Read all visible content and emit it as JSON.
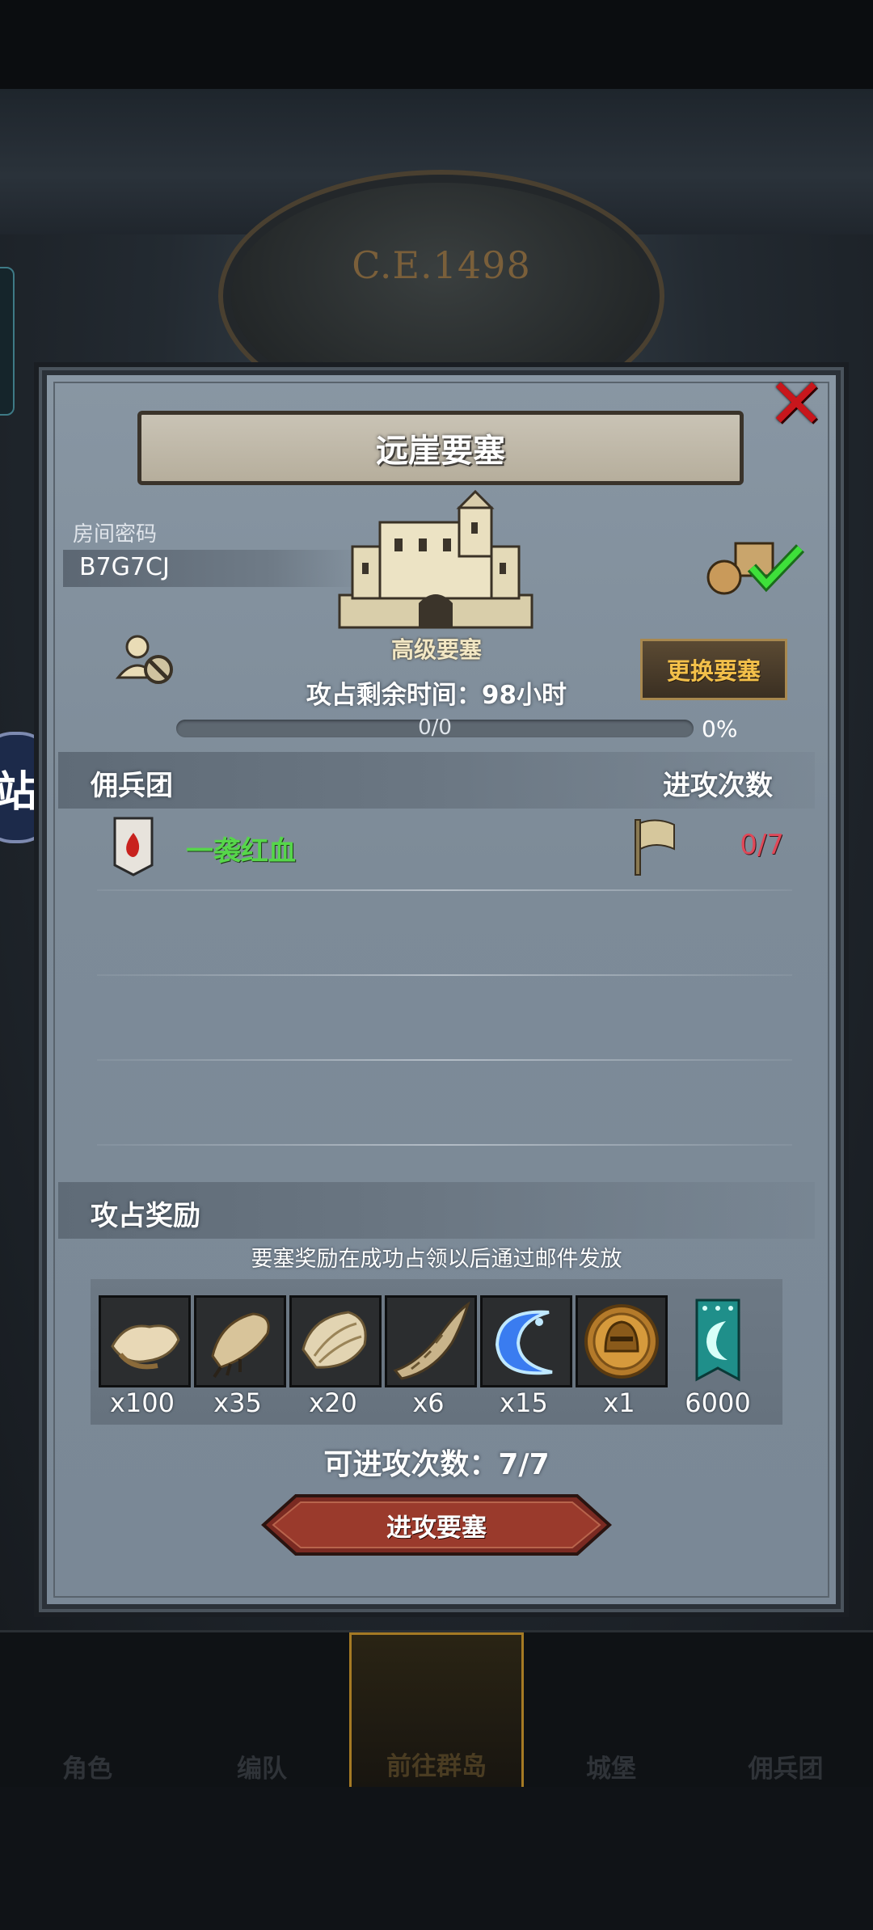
{
  "background": {
    "calendar_year": "C.E.1498",
    "side_badge_text": "站"
  },
  "dialog": {
    "title": "远崖要塞",
    "room_password_label": "房间密码",
    "room_password_value": "B7G7CJ",
    "fortress_type": "高级要塞",
    "change_fortress_label": "更换要塞",
    "capture_time_text": "攻占剩余时间：98小时",
    "progress": {
      "count_text": "0/0",
      "percent_text": "0%",
      "fraction": 0
    },
    "mercenary_section": {
      "title": "佣兵团",
      "attack_count_header": "进攻次数",
      "rows": [
        {
          "name": "一袭红血",
          "attacks": "0/7"
        }
      ]
    },
    "reward_section": {
      "title": "攻占奖励",
      "note": "要塞奖励在成功占领以后通过邮件发放",
      "items": [
        {
          "icon": "fur-pelt-icon",
          "qty": "x100"
        },
        {
          "icon": "claw-icon",
          "qty": "x35"
        },
        {
          "icon": "shell-icon",
          "qty": "x20"
        },
        {
          "icon": "horn-icon",
          "qty": "x6"
        },
        {
          "icon": "blue-crescent-icon",
          "qty": "x15"
        },
        {
          "icon": "helmet-coin-icon",
          "qty": "x1"
        },
        {
          "icon": "guild-banner-icon",
          "qty": "6000"
        }
      ]
    },
    "remaining_attacks_text": "可进攻次数：7/7",
    "attack_button_label": "进攻要塞"
  },
  "bottom_nav": {
    "items": [
      {
        "label": "角色"
      },
      {
        "label": "编队"
      },
      {
        "label": "前往群岛",
        "active": true
      },
      {
        "label": "城堡"
      },
      {
        "label": "佣兵团"
      }
    ]
  },
  "colors": {
    "panel": "#8896a3",
    "accent_gold": "#f3c04a",
    "guild_green": "#56d64a",
    "attack_red": "#e04858",
    "close_red": "#c8161c"
  }
}
